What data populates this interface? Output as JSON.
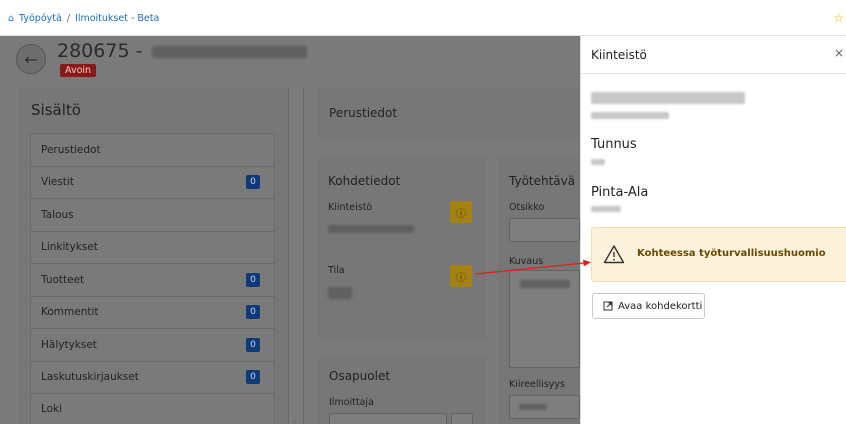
{
  "breadcrumb": {
    "home_label": "Työpöytä",
    "separator": "/",
    "current_label": "Ilmoitukset - Beta"
  },
  "case": {
    "number": "280675 -",
    "status": "Avoin"
  },
  "content_panel": {
    "title": "Sisältö",
    "items": [
      {
        "label": "Perustiedot",
        "count": null
      },
      {
        "label": "Viestit",
        "count": "0"
      },
      {
        "label": "Talous",
        "count": null
      },
      {
        "label": "Linkitykset",
        "count": null
      },
      {
        "label": "Tuotteet",
        "count": "0"
      },
      {
        "label": "Kommentit",
        "count": "0"
      },
      {
        "label": "Hälytykset",
        "count": "0"
      },
      {
        "label": "Laskutuskirjaukset",
        "count": "0"
      },
      {
        "label": "Loki",
        "count": null
      }
    ]
  },
  "basic_info": {
    "title": "Perustiedot"
  },
  "target_info": {
    "title": "Kohdetiedot",
    "property_label": "Kiinteistö",
    "state_label": "Tila"
  },
  "task_info": {
    "title": "Työtehtävä",
    "heading_label": "Otsikko",
    "description_label": "Kuvaus",
    "urgency_label": "Kiireellisyys"
  },
  "parties": {
    "title": "Osapuolet",
    "reporter_label": "Ilmoittaja"
  },
  "side_panel": {
    "title": "Kiinteistö",
    "code_label": "Tunnus",
    "area_label": "Pinta-Ala",
    "warning_text": "Kohteessa työturvallisuushuomio",
    "open_card_label": "Avaa kohdekortti"
  },
  "colors": {
    "accent": "#1a6cc4",
    "warning_bg": "#fdf3dc",
    "warning_text": "#6b4a00",
    "status_badge": "#8a1a1a",
    "count_badge": "#0f3a75",
    "info_button": "#a48211",
    "annotation_arrow": "#e02020"
  },
  "icons": {
    "home": "home-icon",
    "star": "star-icon",
    "back": "arrow-left-icon",
    "info": "info-icon",
    "warning": "warning-triangle-icon",
    "external": "external-link-icon",
    "close": "close-icon"
  }
}
